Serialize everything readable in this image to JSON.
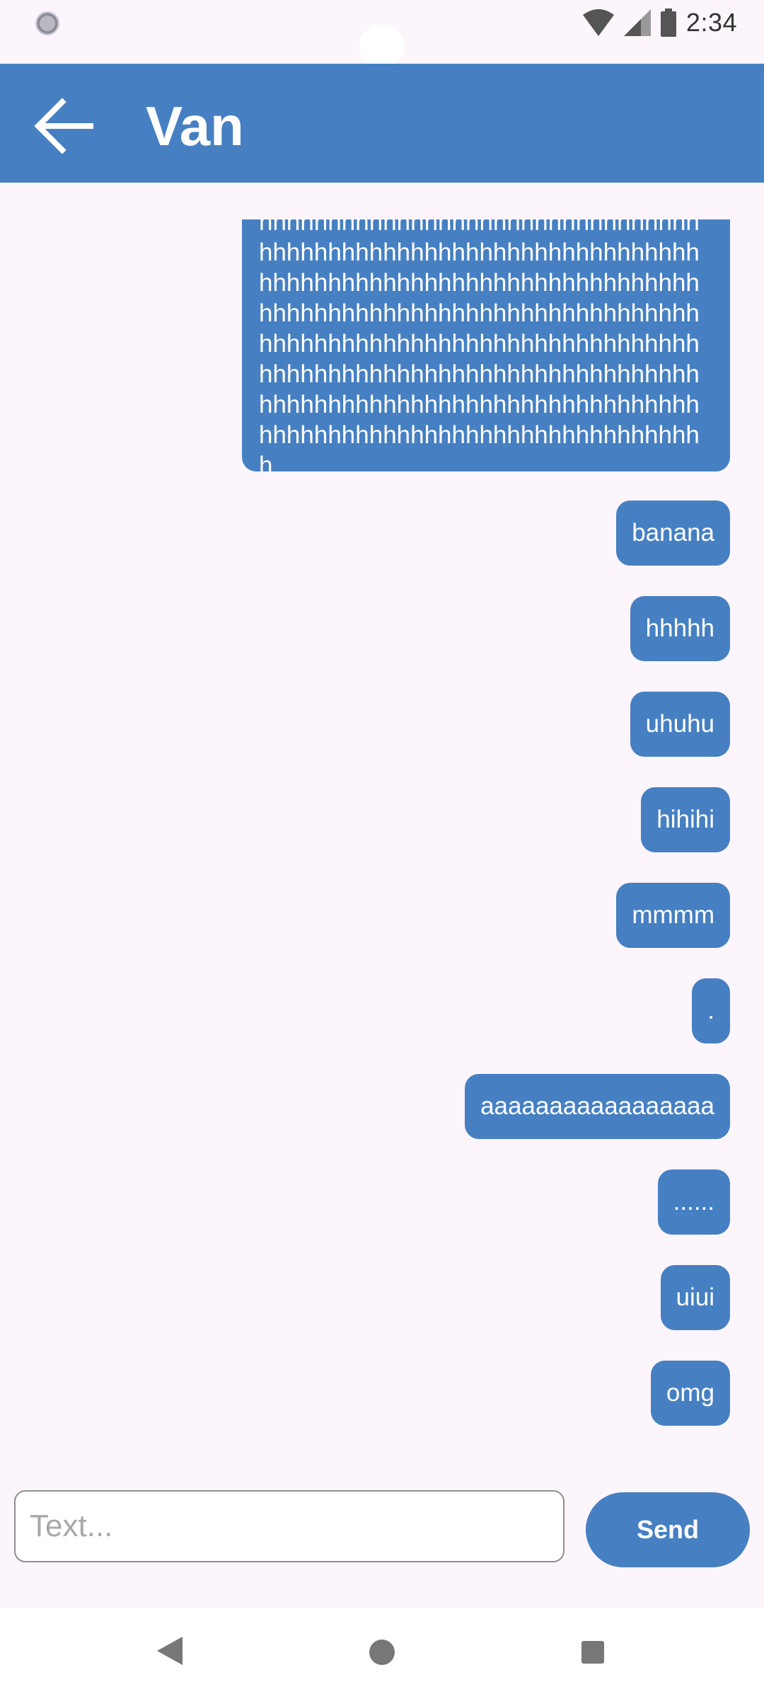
{
  "status_bar": {
    "time": "2:34",
    "icons": [
      "sync-icon",
      "wifi-icon",
      "signal-icon",
      "battery-icon"
    ]
  },
  "app_bar": {
    "back_icon": "arrow-left-icon",
    "title": "Van"
  },
  "messages": [
    {
      "text": "hhhhhhhhhhhhhhhhhhhhhhhhhhhhhhhhhhhhhhhhhhhhhhhhhhhhhhhhhhhhhhhhhhhhhhhhhhhhhhhhhhhhhhhhhhhhhhhhhhhhhhhhhhhhhhhhhhhhhhhhhhhhhhhhhhhhhhhhhhhhhhhhhhhhhhhhhhhhhhhhhhhhhhhhhhhhhhhhhhhhhhhhhhhhhhhhhhhhhhhhhhhhhhhhhhhhhhhhhhhhhhhhhhhhhhhhhhhhhhhhhhhhhhhhhhhhhhhhh"
    },
    {
      "text": "banana"
    },
    {
      "text": "hhhhh"
    },
    {
      "text": "uhuhu"
    },
    {
      "text": "hihihi"
    },
    {
      "text": "mmmm"
    },
    {
      "text": "."
    },
    {
      "text": "aaaaaaaaaaaaaaaaa"
    },
    {
      "text": "......"
    },
    {
      "text": "uiui"
    },
    {
      "text": "omg"
    }
  ],
  "composer": {
    "placeholder": "Text...",
    "value": "",
    "send_label": "Send"
  },
  "colors": {
    "primary": "#4680C2",
    "background": "#FCF5FC"
  },
  "nav_bar": {
    "icons": [
      "nav-back-icon",
      "nav-home-icon",
      "nav-recents-icon"
    ]
  }
}
